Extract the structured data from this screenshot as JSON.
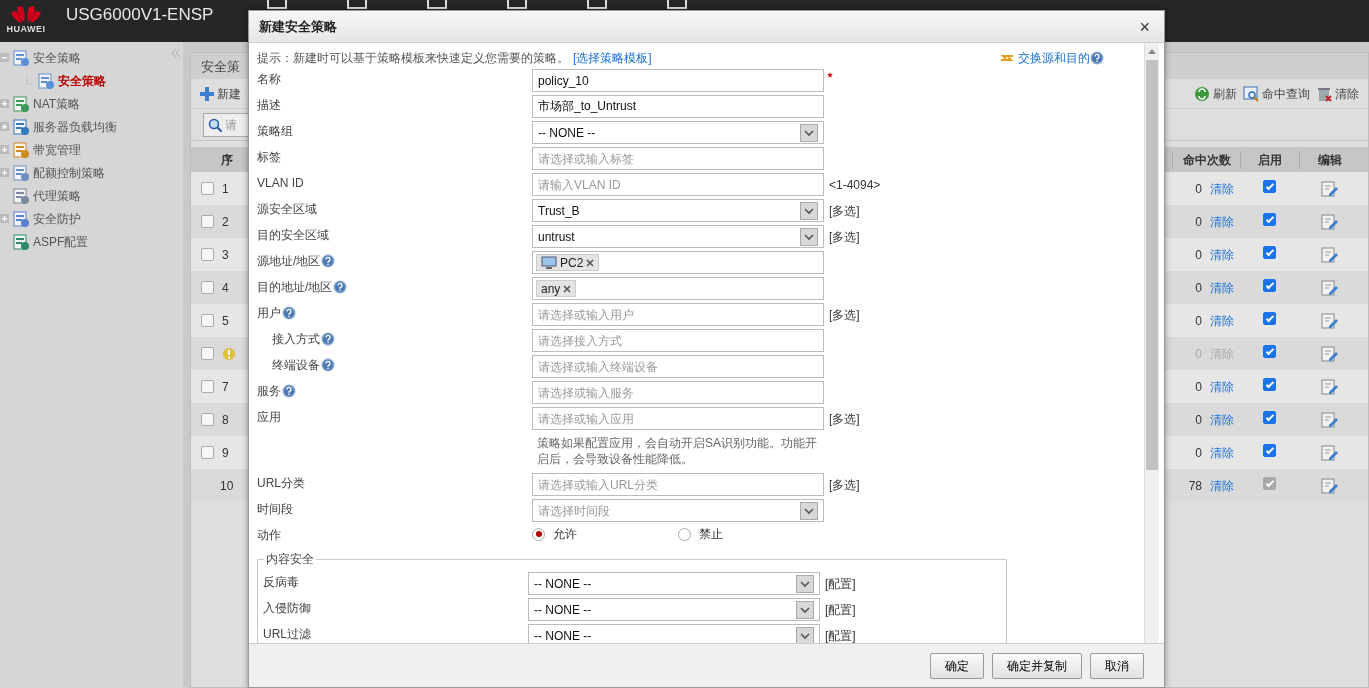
{
  "header": {
    "brand": "HUAWEI",
    "product": "USG6000V1-ENSP"
  },
  "sidebar": {
    "items": [
      {
        "label": "安全策略",
        "kind": "folder",
        "expanded": true,
        "children": [
          {
            "label": "安全策略",
            "selected": true
          }
        ]
      },
      {
        "label": "NAT策略",
        "kind": "folder",
        "expanded": false
      },
      {
        "label": "服务器负载均衡",
        "kind": "folder",
        "expanded": false
      },
      {
        "label": "带宽管理",
        "kind": "folder",
        "expanded": false
      },
      {
        "label": "配额控制策略",
        "kind": "folder",
        "expanded": false
      },
      {
        "label": "代理策略",
        "kind": "leaf"
      },
      {
        "label": "安全防护",
        "kind": "folder",
        "expanded": false
      },
      {
        "label": "ASPF配置",
        "kind": "leaf"
      }
    ]
  },
  "panel": {
    "tab": "安全策",
    "new_button": "新建",
    "search_placeholder": "请",
    "tools": [
      "刷新",
      "命中查询",
      "清除"
    ],
    "columns_left": [
      "序"
    ],
    "columns_right": [
      "命中次数",
      "启用",
      "编辑"
    ],
    "rows": [
      {
        "kind": "normal",
        "number": "1",
        "selected": false,
        "hits": "0",
        "clear": "清除",
        "enabled": true
      },
      {
        "kind": "normal",
        "number": "2",
        "selected": false,
        "hits": "0",
        "clear": "清除",
        "enabled": true
      },
      {
        "kind": "normal",
        "number": "3",
        "selected": false,
        "hits": "0",
        "clear": "清除",
        "enabled": true
      },
      {
        "kind": "normal",
        "number": "4",
        "selected": false,
        "hits": "0",
        "clear": "清除",
        "enabled": true
      },
      {
        "kind": "normal",
        "number": "5",
        "selected": false,
        "hits": "0",
        "clear": "清除",
        "enabled": true
      },
      {
        "kind": "warning",
        "selected": false,
        "hits": "0",
        "clear": "清除",
        "enabled": true
      },
      {
        "kind": "normal",
        "number": "7",
        "selected": false,
        "hits": "0",
        "clear": "清除",
        "enabled": true
      },
      {
        "kind": "normal",
        "number": "8",
        "selected": false,
        "hits": "0",
        "clear": "清除",
        "enabled": true
      },
      {
        "kind": "normal",
        "number": "9",
        "selected": false,
        "hits": "0",
        "clear": "清除",
        "enabled": true
      },
      {
        "kind": "default",
        "number": "10",
        "hits": "78",
        "clear": "清除",
        "enabled": true
      }
    ]
  },
  "dialog": {
    "title": "新建安全策略",
    "close": "×",
    "hint": "提示：新建时可以基于策略模板来快速定义您需要的策略。",
    "template_link": "[选择策略模板]",
    "swap_link": "交换源和目的",
    "fields": [
      {
        "kind": "text",
        "label": "名称",
        "value": "policy_10",
        "required": true
      },
      {
        "kind": "text",
        "label": "描述",
        "value": "市场部_to_Untrust"
      },
      {
        "kind": "select",
        "label": "策略组",
        "value": "-- NONE --"
      },
      {
        "kind": "text",
        "label": "标签",
        "placeholder": "请选择或输入标签"
      },
      {
        "kind": "text",
        "label": "VLAN ID",
        "placeholder": "请输入VLAN ID",
        "suffix": "<1-4094>"
      },
      {
        "kind": "select",
        "label": "源安全区域",
        "value": "Trust_B",
        "link": "[多选]"
      },
      {
        "kind": "select",
        "label": "目的安全区域",
        "value": "untrust",
        "link": "[多选]"
      },
      {
        "kind": "tags",
        "label": "源地址/地区",
        "help": true,
        "tags": [
          {
            "label": "PC2",
            "kind": "host"
          }
        ]
      },
      {
        "kind": "tags",
        "label": "目的地址/地区",
        "help": true,
        "tags": [
          {
            "label": "any",
            "kind": "plain"
          }
        ]
      },
      {
        "kind": "text",
        "label": "用户",
        "help": true,
        "placeholder": "请选择或输入用户",
        "link": "[多选]",
        "children": [
          {
            "kind": "text",
            "label": "接入方式",
            "help": true,
            "placeholder": "请选择接入方式"
          },
          {
            "kind": "text",
            "label": "终端设备",
            "help": true,
            "placeholder": "请选择或输入终端设备"
          }
        ]
      },
      {
        "kind": "text",
        "label": "服务",
        "help": true,
        "placeholder": "请选择或输入服务"
      },
      {
        "kind": "text",
        "label": "应用",
        "placeholder": "请选择或输入应用",
        "link": "[多选]",
        "note": "策略如果配置应用，会自动开启SA识别功能。功能开启后，会导致设备性能降低。"
      },
      {
        "kind": "text",
        "label": "URL分类",
        "placeholder": "请选择或输入URL分类",
        "link": "[多选]"
      },
      {
        "kind": "select",
        "label": "时间段",
        "placeholder": "请选择时间段"
      },
      {
        "kind": "radio",
        "label": "动作",
        "options": [
          {
            "label": "允许",
            "selected": true
          },
          {
            "label": "禁止",
            "selected": false
          }
        ]
      }
    ],
    "content_security": {
      "legend": "内容安全",
      "rows": [
        {
          "label": "反病毒",
          "value": "-- NONE --",
          "link": "[配置]"
        },
        {
          "label": "入侵防御",
          "value": "-- NONE --",
          "link": "[配置]"
        },
        {
          "label": "URL过滤",
          "value": "-- NONE --",
          "link": "[配置]"
        }
      ]
    },
    "buttons": [
      "确定",
      "确定并复制",
      "取消"
    ]
  }
}
